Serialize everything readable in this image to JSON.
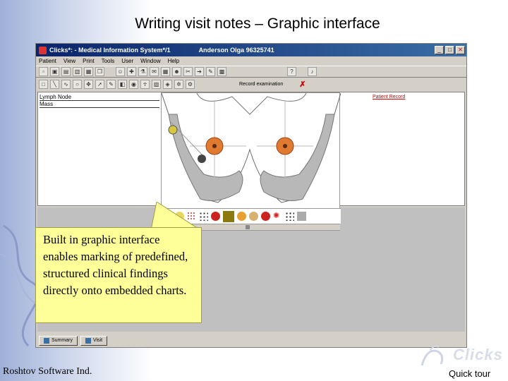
{
  "slide": {
    "title": "Writing visit notes – Graphic interface",
    "company": "Roshtov Software Ind.",
    "quick_tour": "Quick tour",
    "logo_text": "Clicks"
  },
  "window": {
    "title": "Clicks*: - Medical Information System*/1",
    "patient": "Anderson Olga 96325741",
    "menu": [
      "Patient",
      "View",
      "Print",
      "Tools",
      "User",
      "Window",
      "Help"
    ],
    "record_label": "Record examination",
    "left_list": [
      "Lymph Node",
      "Mass"
    ],
    "right_link": "Patient Record",
    "status_buttons": [
      "Summary",
      "Visit"
    ]
  },
  "callout": {
    "text": "Built in graphic interface enables marking of predefined, structured clinical findings directly onto embedded charts."
  },
  "colors": {
    "title_bar": "#0a246a",
    "callout_bg": "#ffff99",
    "window_bg": "#d4d0c8"
  }
}
